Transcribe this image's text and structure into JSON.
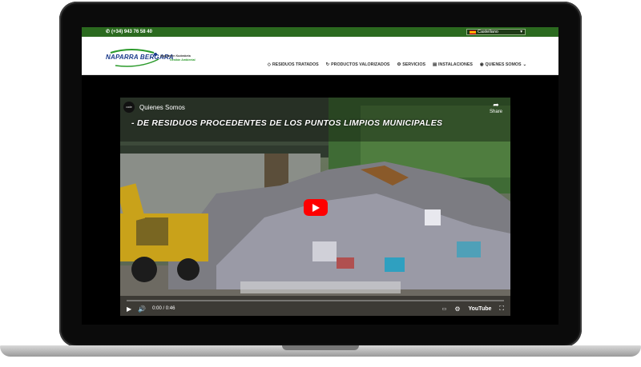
{
  "topbar": {
    "phone": "(+34) 943 76 58 40",
    "language": "Castellano"
  },
  "brand": {
    "name": "NAPARRA BERGARA",
    "tagline1": "Ingurumen Kudeaketa",
    "tagline2": "Gestión Ambiental"
  },
  "nav": {
    "items": [
      {
        "label": "RESIDUOS TRATADOS",
        "icon": "recycle-icon"
      },
      {
        "label": "PRODUCTOS VALORIZADOS",
        "icon": "refresh-icon"
      },
      {
        "label": "SERVICIOS",
        "icon": "gear-icon"
      },
      {
        "label": "INSTALACIONES",
        "icon": "building-icon"
      },
      {
        "label": "QUIENES SOMOS",
        "icon": "globe-icon"
      }
    ]
  },
  "video": {
    "title": "Quienes Somos",
    "channel_logo_text": "cade",
    "share_label": "Share",
    "banner_text": "- DE RESIDUOS PROCEDENTES DE LOS PUNTOS LIMPIOS MUNICIPALES",
    "time": "0:00 / 0:46",
    "platform": "YouTube"
  },
  "colors": {
    "topbar": "#2b6a1f",
    "play_button": "#ff0000",
    "brand_blue": "#1a3a8a",
    "brand_green": "#2b9a2b"
  }
}
